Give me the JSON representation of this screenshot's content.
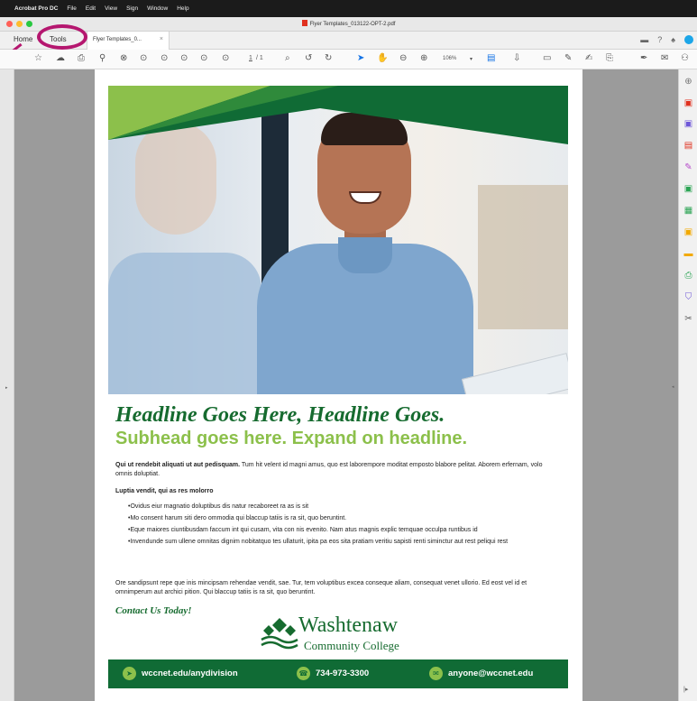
{
  "menubar": {
    "app_name": "Acrobat Pro DC",
    "items": [
      "File",
      "Edit",
      "View",
      "Sign",
      "Window",
      "Help"
    ]
  },
  "window": {
    "title": "Flyer Templates_013122-OPT-2.pdf"
  },
  "tabs": {
    "home": "Home",
    "tools": "Tools",
    "document": "Flyer Templates_0...",
    "close_glyph": "×"
  },
  "toolbar": {
    "page_current": "1",
    "page_total": "/ 1",
    "zoom": "106%"
  },
  "flyer": {
    "headline": "Headline Goes Here, Headline Goes.",
    "subhead": "Subhead goes here. Expand on headline.",
    "intro_bold": "Qui ut rendebit aliquati ut aut pedisquam.",
    "intro_text": " Tum hit velent id magni amus, quo est laborempore moditat emposto blabore pelitat. Aborem erfernam, volo omnis doluptiat.",
    "section_title": "Luptia vendit, qui as res molorro",
    "bullets": [
      "•Ovidus eiur magnatio doluptibus dis natur recaboreet ra as is sit",
      "•Mo consent harum siti dero ommodia qui blaccup tatiis is ra sit, quo beruntint.",
      "•Eque maiores ciuntibusdam faccum int qui cusam, vita con nis evenito. Nam atus magnis explic temquae occulpa runtibus id",
      "•Invendunde sum ullene omnitas dignim nobitatquo tes ullaturit, ipita pa eos sita pratiam veritiu sapisti renti siminctur aut rest peliqui rest"
    ],
    "closing_text": "Ore sandipsunt repe que inis mincipsam rehendae vendit, sae. Tur, tem voluptibus excea conseque aliam, consequat venet ullorio. Ed eost vel id et omnimperum aut archici pition. Qui blaccup tatiis is ra sit, quo beruntint.",
    "contact_heading": "Contact Us Today!",
    "logo_name": "Washtenaw",
    "logo_sub": "Community College",
    "footer": {
      "website": "wccnet.edu/anydivision",
      "phone": "734-973-3300",
      "email": "anyone@wccnet.edu"
    }
  },
  "colors": {
    "brand_green": "#166b2f",
    "accent_green": "#8cc04b",
    "highlight_magenta": "#b5176f"
  }
}
